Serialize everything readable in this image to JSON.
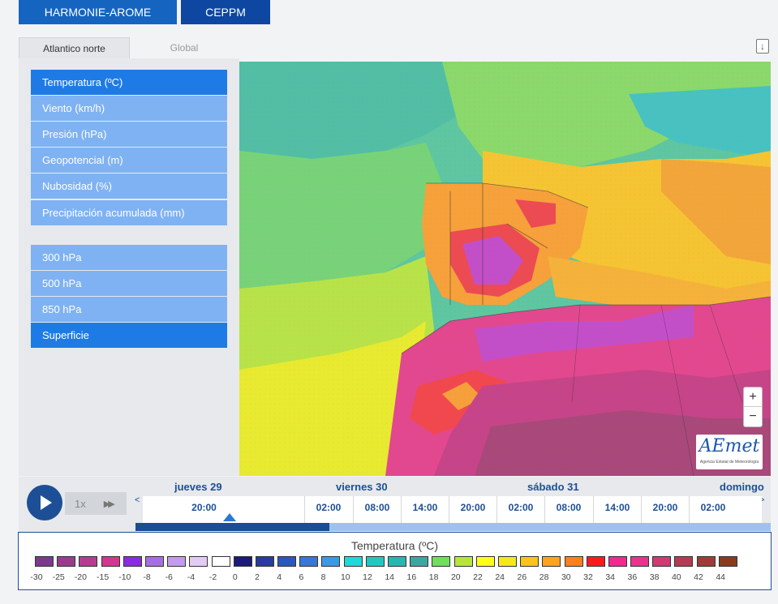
{
  "model_buttons": [
    "HARMONIE-AROME",
    "CEPPM"
  ],
  "region_tabs": [
    "Atlantico norte",
    "Global"
  ],
  "variables": [
    {
      "label": "Temperatura (ºC)",
      "active": true
    },
    {
      "label": "Viento (km/h)",
      "active": false
    },
    {
      "label": "Presión (hPa)",
      "active": false
    },
    {
      "label": "Geopotencial (m)",
      "active": false
    },
    {
      "label": "Nubosidad (%)",
      "active": false
    },
    {
      "label": "Precipitación acumulada (mm)",
      "active": false
    }
  ],
  "levels": [
    {
      "label": "300 hPa",
      "active": false
    },
    {
      "label": "500 hPa",
      "active": false
    },
    {
      "label": "850 hPa",
      "active": false
    },
    {
      "label": "Superficie",
      "active": true
    }
  ],
  "map": {
    "zoom_in": "+",
    "zoom_out": "−",
    "logo_text": "AEmet",
    "logo_sub": "Agencia Estatal de Meteorología"
  },
  "timeline": {
    "speed": "1x",
    "days": [
      "jueves 29",
      "viernes 30",
      "sábado 31",
      "domingo"
    ],
    "times": [
      "20:00",
      "02:00",
      "08:00",
      "14:00",
      "20:00",
      "02:00",
      "08:00",
      "14:00",
      "20:00",
      "02:00"
    ],
    "current_index": 0,
    "progress": 0.305
  },
  "legend": {
    "title": "Temperatura (ºC)",
    "colors": [
      "#7b3a8e",
      "#9c3b8c",
      "#b83c8e",
      "#d4368f",
      "#8a2be2",
      "#a66ee6",
      "#c49af0",
      "#e2ccf5",
      "#ffffff",
      "#1a1a7a",
      "#2a3a9e",
      "#2b58c0",
      "#3478d8",
      "#3a9ae8",
      "#1fd8d8",
      "#21c8c0",
      "#25b8b0",
      "#3aa8a0",
      "#6ee05a",
      "#b6e63a",
      "#ffff1a",
      "#f5e91a",
      "#ffc21a",
      "#ffa31a",
      "#ff7f1a",
      "#ff1a1a",
      "#f02a8e",
      "#e8348f",
      "#d13a73",
      "#b73a54",
      "#a33a3a",
      "#8b3a1a"
    ],
    "labels": [
      "-30",
      "-25",
      "-20",
      "-15",
      "-10",
      "-8",
      "-6",
      "-4",
      "-2",
      "0",
      "2",
      "4",
      "6",
      "8",
      "10",
      "12",
      "14",
      "16",
      "18",
      "20",
      "22",
      "24",
      "26",
      "28",
      "30",
      "32",
      "34",
      "36",
      "38",
      "40",
      "42",
      "44"
    ]
  }
}
